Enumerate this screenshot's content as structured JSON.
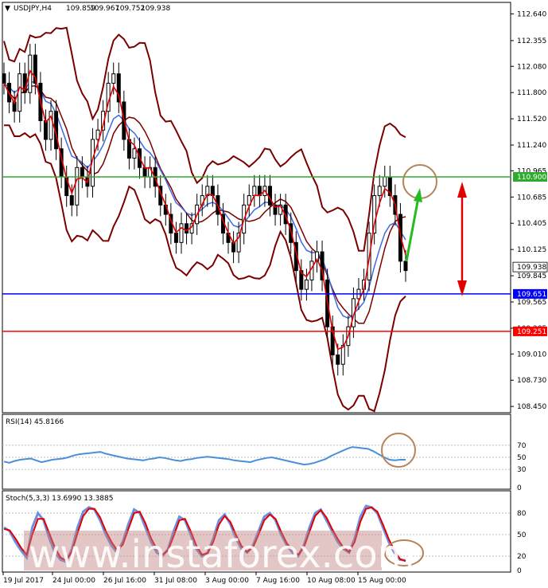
{
  "header": {
    "symbol": "USDJPY,H4",
    "open": "109.859",
    "high": "109.967",
    "low": "109.752",
    "close": "109.938"
  },
  "watermark": "www.instaforex.com",
  "chart_data": [
    {
      "type": "candlestick",
      "panel": "price",
      "ylim": [
        108.4,
        112.72
      ],
      "y_ticks": [
        "112.640",
        "112.355",
        "112.080",
        "111.800",
        "111.520",
        "111.240",
        "110.965",
        "110.685",
        "110.405",
        "110.125",
        "109.845",
        "109.565",
        "109.285",
        "109.010",
        "108.730",
        "108.450"
      ],
      "levels": [
        {
          "value": 110.9,
          "label": "110.900",
          "color": "#2eaa2e"
        },
        {
          "value": 109.651,
          "label": "109.651",
          "color": "#0000ff"
        },
        {
          "value": 109.251,
          "label": "109.251",
          "color": "#ff0000"
        }
      ],
      "current_price": "109.938",
      "close_series": [
        111.9,
        111.7,
        111.6,
        112.0,
        111.8,
        112.2,
        111.9,
        111.5,
        111.3,
        111.6,
        111.2,
        110.9,
        110.7,
        110.6,
        111.0,
        110.9,
        110.8,
        111.3,
        111.4,
        111.6,
        111.9,
        112.0,
        111.7,
        111.3,
        111.1,
        111.2,
        111.0,
        110.9,
        111.0,
        110.8,
        110.6,
        110.5,
        110.3,
        110.2,
        110.4,
        110.3,
        110.4,
        110.6,
        110.7,
        110.8,
        110.7,
        110.5,
        110.3,
        110.2,
        110.1,
        110.3,
        110.6,
        110.7,
        110.8,
        110.7,
        110.8,
        110.6,
        110.5,
        110.6,
        110.4,
        110.2,
        109.9,
        109.7,
        109.8,
        110.0,
        110.1,
        109.8,
        109.3,
        109.0,
        108.9,
        109.1,
        109.3,
        109.6,
        109.7,
        109.8,
        110.3,
        110.7,
        110.8,
        110.9,
        110.7,
        110.5,
        110.0,
        109.9
      ],
      "indicators": [
        "Bollinger Bands",
        "Moving averages (red, blue)"
      ]
    },
    {
      "type": "line",
      "panel": "rsi",
      "title": "RSI(14) 45.8166",
      "ylim": [
        0,
        100
      ],
      "y_ticks": [
        "70",
        "50",
        "30",
        "0"
      ],
      "values": [
        43,
        41,
        44,
        46,
        47,
        48,
        45,
        42,
        44,
        46,
        47,
        48,
        50,
        53,
        55,
        56,
        57,
        58,
        59,
        56,
        54,
        52,
        50,
        48,
        47,
        46,
        45,
        47,
        48,
        50,
        49,
        47,
        45,
        44,
        46,
        47,
        49,
        50,
        51,
        50,
        49,
        48,
        47,
        45,
        44,
        43,
        42,
        45,
        47,
        49,
        50,
        48,
        46,
        44,
        42,
        40,
        38,
        39,
        41,
        44,
        47,
        52,
        56,
        60,
        64,
        67,
        66,
        65,
        64,
        60,
        55,
        50,
        46,
        45,
        46,
        46
      ]
    },
    {
      "type": "line",
      "panel": "stochastic",
      "title": "Stoch(5,3,3) 13.6990 13.3885",
      "ylim": [
        0,
        100
      ],
      "y_ticks": [
        "80",
        "50",
        "20",
        "0"
      ],
      "series": [
        {
          "name": "main",
          "color": "#6c8fe0",
          "values": [
            60,
            55,
            40,
            28,
            18,
            60,
            80,
            70,
            45,
            25,
            15,
            12,
            30,
            60,
            82,
            88,
            85,
            70,
            50,
            35,
            25,
            40,
            65,
            85,
            80,
            60,
            40,
            25,
            20,
            30,
            55,
            75,
            70,
            50,
            30,
            20,
            25,
            45,
            70,
            78,
            65,
            45,
            30,
            25,
            35,
            55,
            75,
            80,
            70,
            50,
            35,
            25,
            20,
            35,
            60,
            80,
            85,
            70,
            55,
            40,
            30,
            25,
            45,
            75,
            90,
            88,
            80,
            60,
            40,
            25,
            15,
            14
          ]
        },
        {
          "name": "signal",
          "color": "#e00000",
          "values": [
            58,
            56,
            45,
            32,
            22,
            50,
            72,
            72,
            52,
            32,
            18,
            14,
            26,
            52,
            76,
            86,
            86,
            74,
            55,
            40,
            28,
            36,
            58,
            80,
            82,
            66,
            45,
            30,
            22,
            28,
            48,
            70,
            72,
            55,
            35,
            22,
            24,
            40,
            64,
            76,
            68,
            50,
            34,
            26,
            32,
            50,
            70,
            78,
            72,
            54,
            38,
            28,
            22,
            32,
            54,
            76,
            84,
            74,
            58,
            44,
            32,
            26,
            40,
            68,
            86,
            88,
            82,
            64,
            44,
            28,
            16,
            13
          ]
        }
      ]
    }
  ],
  "x_labels": [
    "19 Jul 2017",
    "24 Jul 00:00",
    "26 Jul 16:00",
    "31 Jul 08:00",
    "3 Aug 00:00",
    "7 Aug 16:00",
    "10 Aug 08:00",
    "15 Aug 00:00"
  ],
  "colors": {
    "candle": "#000000",
    "bands": "#7a0000",
    "ma_red": "#e00000",
    "ma_blue": "#4169e1",
    "circle": "#b5835a",
    "arrow_up": "#22bb22",
    "arrow_range": "#e00000"
  }
}
